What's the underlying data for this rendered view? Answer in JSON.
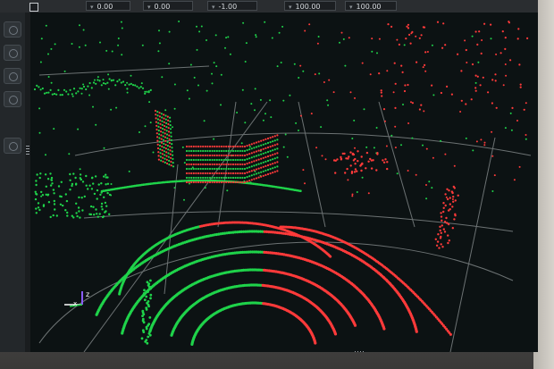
{
  "toolbar": {
    "fields": [
      {
        "value": "0.00"
      },
      {
        "value": "0.00"
      },
      {
        "value": "-1.00"
      },
      {
        "value": "100.00"
      },
      {
        "value": "100.00"
      }
    ]
  },
  "left_panel": {
    "buttons": [
      "gear-icon",
      "camera-icon",
      "target-icon",
      "record-icon",
      "settings-icon"
    ]
  },
  "colors": {
    "green": "#1fd34a",
    "red": "#ff3a3a",
    "grid": "#7d8384",
    "background": "#0c1213"
  }
}
